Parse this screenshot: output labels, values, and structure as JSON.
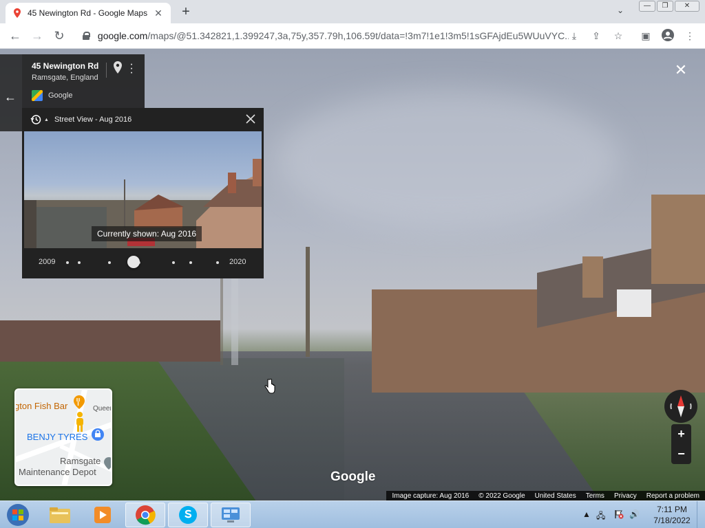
{
  "browser": {
    "tab_title": "45 Newington Rd - Google Maps",
    "url_host": "google.com",
    "url_path": "/maps/@51.342821,1.399247,3a,75y,357.79h,106.59t/data=!3m7!1e1!3m5!1sGFAjdEu5WUuVYC..."
  },
  "place": {
    "title": "45 Newington Rd",
    "subtitle": "Ramsgate, England",
    "brand": "Google"
  },
  "time_travel": {
    "title": "Street View - Aug 2016",
    "caption": "Currently shown: Aug 2016",
    "start_year": "2009",
    "end_year": "2020",
    "selected_position": 0.44
  },
  "minimap": {
    "label_fish_bar": "gton Fish Bar",
    "label_queens": "Queens",
    "label_tyres": "BENJY TYRES",
    "label_depot_1": "Ramsgate",
    "label_depot_2": "Maintenance Depot"
  },
  "controls": {
    "zoom_in": "+",
    "zoom_out": "−"
  },
  "watermark": "Google",
  "footer": {
    "capture": "Image capture: Aug 2016",
    "copyright": "© 2022 Google",
    "region": "United States",
    "terms": "Terms",
    "privacy": "Privacy",
    "report": "Report a problem"
  },
  "taskbar": {
    "time": "7:11 PM",
    "date": "7/18/2022"
  },
  "colors": {
    "panel_bg": "#222222",
    "accent_red": "#e53935",
    "maps_blue": "#1a73e8"
  }
}
